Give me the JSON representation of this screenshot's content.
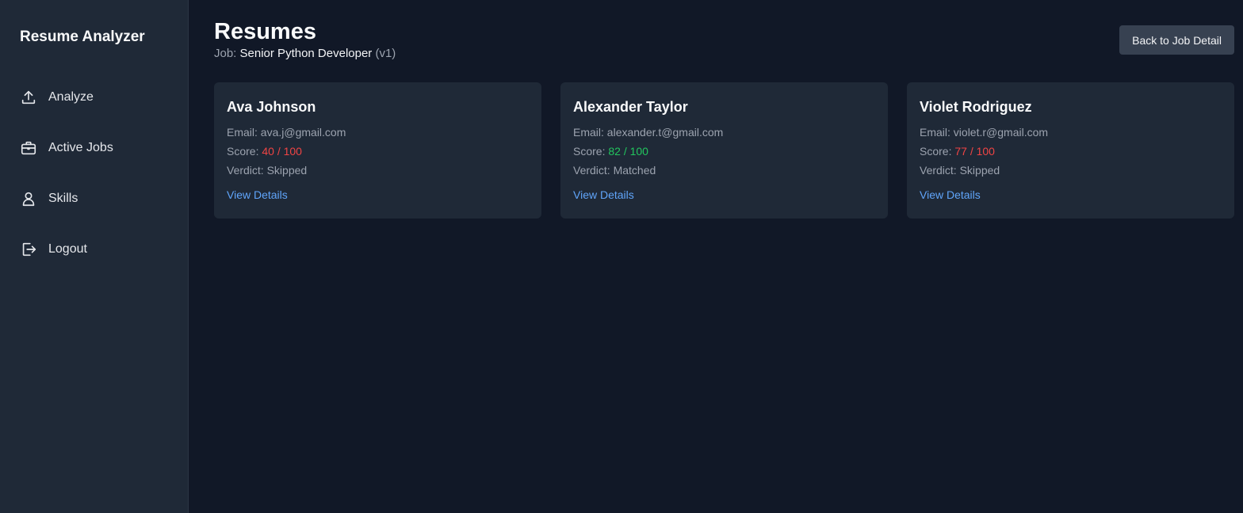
{
  "sidebar": {
    "brand": "Resume Analyzer",
    "items": [
      {
        "label": "Analyze",
        "icon": "upload-icon"
      },
      {
        "label": "Active Jobs",
        "icon": "briefcase-icon"
      },
      {
        "label": "Skills",
        "icon": "user-icon"
      },
      {
        "label": "Logout",
        "icon": "logout-icon"
      }
    ]
  },
  "header": {
    "title": "Resumes",
    "job_prefix": "Job:",
    "job_name": "Senior Python Developer",
    "job_version": "(v1)",
    "back_button": "Back to Job Detail"
  },
  "labels": {
    "email": "Email:",
    "score": "Score:",
    "verdict": "Verdict:",
    "view_details": "View Details"
  },
  "colors": {
    "score_low": "#ef4444",
    "score_high": "#22c55e",
    "link": "#60a5fa"
  },
  "resumes": [
    {
      "name": "Ava Johnson",
      "email": "ava.j@gmail.com",
      "score": "40 / 100",
      "verdict": "Skipped",
      "score_status": "low"
    },
    {
      "name": "Alexander Taylor",
      "email": "alexander.t@gmail.com",
      "score": "82 / 100",
      "verdict": "Matched",
      "score_status": "high"
    },
    {
      "name": "Violet Rodriguez",
      "email": "violet.r@gmail.com",
      "score": "77 / 100",
      "verdict": "Skipped",
      "score_status": "low"
    }
  ]
}
